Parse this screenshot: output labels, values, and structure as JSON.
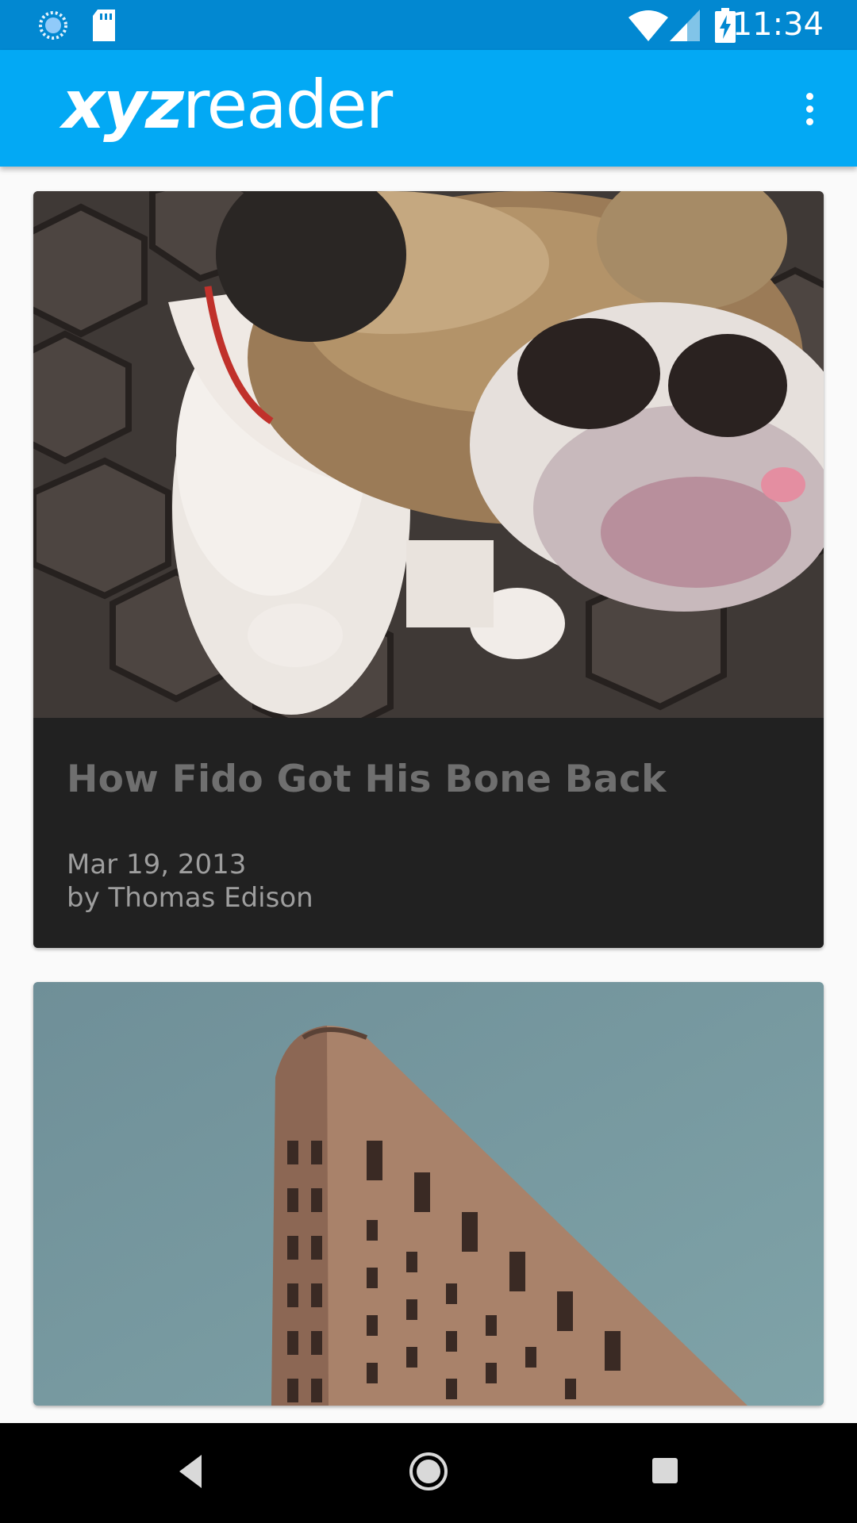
{
  "status_bar": {
    "time": "11:34"
  },
  "app_bar": {
    "title_bold": "xyz",
    "title_light": "reader"
  },
  "articles": [
    {
      "title": "How Fido Got His Bone Back",
      "date": "Mar 19, 2013",
      "author": "by Thomas Edison",
      "image": "bulldog-photo"
    },
    {
      "image": "flatiron-building-photo"
    }
  ],
  "colors": {
    "status_bar": "#0288d1",
    "app_bar": "#03a9f4",
    "card_text_bg": "#212121",
    "background": "#fafafa"
  },
  "icons": [
    "sync-icon",
    "sd-card-icon",
    "wifi-icon",
    "signal-icon",
    "battery-charging-icon",
    "overflow-menu-icon",
    "back-icon",
    "home-icon",
    "recents-icon"
  ]
}
